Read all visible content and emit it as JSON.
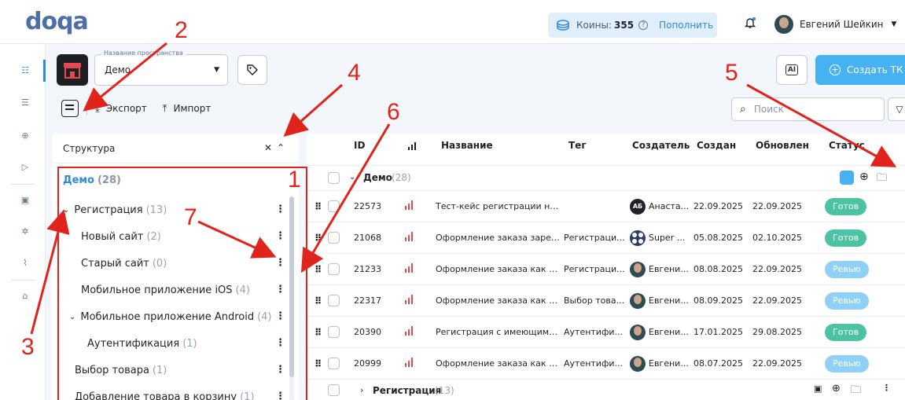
{
  "app": {
    "logo": "doqa"
  },
  "header": {
    "coins_label": "Коины:",
    "coins_value": "355",
    "help_glyph": "?",
    "topup_label": "Пополнить",
    "user_name": "Евгений Шейкин"
  },
  "space": {
    "field_legend": "Название пространства",
    "field_value": "Демо"
  },
  "actions": {
    "ai_label": "AI",
    "create_label": "Создать ТК"
  },
  "toolbar": {
    "export_label": "Экспорт",
    "import_label": "Импорт",
    "search_placeholder": "Поиск"
  },
  "structure": {
    "title": "Структура",
    "items": [
      {
        "label": "Демо",
        "count": "(28)"
      },
      {
        "label": "Регистрация",
        "count": "(13)"
      },
      {
        "label": "Новый сайт",
        "count": "(2)"
      },
      {
        "label": "Старый сайт",
        "count": "(0)"
      },
      {
        "label": "Мобильное приложение iOS",
        "count": "(4)"
      },
      {
        "label": "Мобильное приложение Android",
        "count": "(4)"
      },
      {
        "label": "Аутентификация",
        "count": "(1)"
      },
      {
        "label": "Выбор товара",
        "count": "(1)"
      },
      {
        "label": "Добавление товара в корзину",
        "count": "(1)"
      }
    ]
  },
  "table": {
    "columns": [
      "ID",
      "Название",
      "Тег",
      "Создатель",
      "Создан",
      "Обновлен",
      "Статус"
    ],
    "group": {
      "name": "Демо",
      "count": "(28)"
    },
    "rows": [
      {
        "id": "22573",
        "name": "Тест-кейс регистрации нов...",
        "tag": "",
        "creator_initials": "АБ",
        "creator": "Анаста...",
        "created": "22.09.2025",
        "updated": "22.09.2025",
        "status": "Готов"
      },
      {
        "id": "21068",
        "name": "Оформление заказа зарег...",
        "tag": "Регистраци...",
        "creator_initials": "",
        "creator": "Super ...",
        "created": "05.08.2025",
        "updated": "02.10.2025",
        "status": "Готов"
      },
      {
        "id": "21233",
        "name": "Оформление заказа как го...",
        "tag": "Регистраци...",
        "creator_initials": "",
        "creator": "Евгени...",
        "created": "08.08.2025",
        "updated": "22.09.2025",
        "status": "Ревью"
      },
      {
        "id": "22317",
        "name": "Оформление заказа как го...",
        "tag": "Выбор това...",
        "creator_initials": "",
        "creator": "Евгени...",
        "created": "08.09.2025",
        "updated": "22.09.2025",
        "status": "Ревью"
      },
      {
        "id": "20390",
        "name": "Регистрация с имеющимс...",
        "tag": "Аутентифи...",
        "creator_initials": "",
        "creator": "Евгени...",
        "created": "17.01.2025",
        "updated": "29.08.2025",
        "status": "Готов"
      },
      {
        "id": "20999",
        "name": "Оформление заказа как го...",
        "tag": "Аутентифи...",
        "creator_initials": "",
        "creator": "Евгени...",
        "created": "08.07.2025",
        "updated": "22.09.2025",
        "status": "Ревью"
      }
    ],
    "subgroup": {
      "name": "Регистрация",
      "count": "(13)"
    }
  },
  "annotations": [
    "1",
    "2",
    "3",
    "4",
    "5",
    "6",
    "7"
  ],
  "colors": {
    "accent": "#2d8ae0",
    "create_button": "#46b2f2",
    "status_ready": "#4cc3a3",
    "status_review": "#8fd0f7",
    "annotation": "#e0241b",
    "priority": "#e5484d"
  }
}
